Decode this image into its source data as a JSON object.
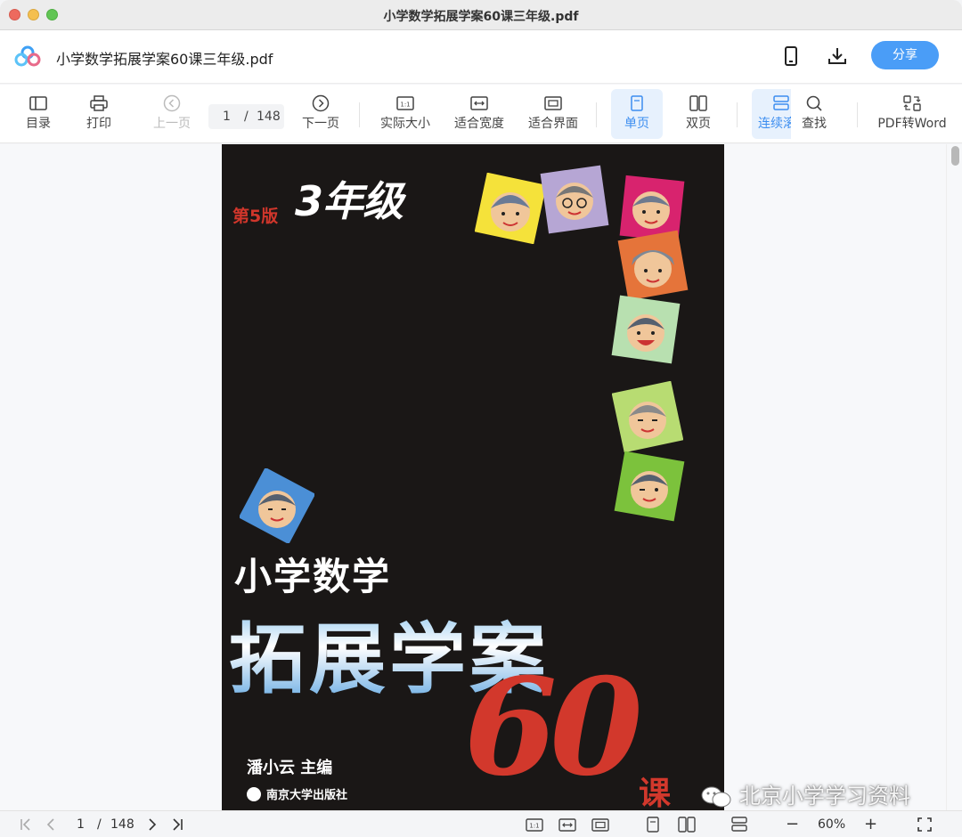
{
  "window": {
    "title": "小学数学拓展学案60课三年级.pdf"
  },
  "header": {
    "doc_title": "小学数学拓展学案60课三年级.pdf",
    "share_label": "分享"
  },
  "toolbar": {
    "toc": "目录",
    "print": "打印",
    "prev": "上一页",
    "page_current": "1",
    "page_sep": "/",
    "page_total": "148",
    "next": "下一页",
    "actual_size": "实际大小",
    "fit_width": "适合宽度",
    "fit_page": "适合界面",
    "single": "单页",
    "double": "双页",
    "continuous": "连续滚",
    "find": "查找",
    "pdf_to_word": "PDF转Word"
  },
  "cover": {
    "edition": "第5版",
    "grade": "3年级",
    "title_line1": "小学数学",
    "title_line2": "拓展学案",
    "number": "60",
    "lesson": "课",
    "author": "潘小云 主编",
    "publisher": "南京大学出版社"
  },
  "watermark": "北京小学学习资料",
  "bottombar": {
    "page_current": "1",
    "page_sep": "/",
    "page_total": "148",
    "zoom": "60%",
    "zoom_minus": "−",
    "zoom_plus": "+"
  },
  "colors": {
    "accent": "#4a9df7",
    "active_bg": "#e7f1fd",
    "cover_bg": "#1a1716",
    "cover_red": "#d2382c"
  }
}
